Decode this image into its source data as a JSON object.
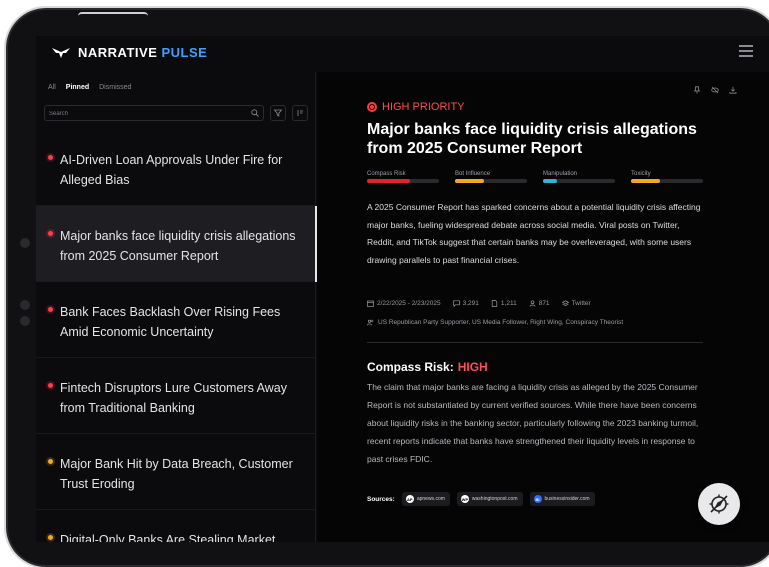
{
  "app": {
    "brand_main": "NARRATIVE",
    "brand_accent": "PULSE",
    "accent_color": "#3ea0ff"
  },
  "filters": {
    "all": "All",
    "pinned": "Pinned",
    "dismissed": "Dismissed",
    "active": "Pinned"
  },
  "search": {
    "placeholder": "Search",
    "value": ""
  },
  "list": [
    {
      "title": "AI-Driven Loan Approvals Under Fire for Alleged Bias",
      "priority_color": "#ff3b4e",
      "selected": false
    },
    {
      "title": "Major banks face liquidity crisis allegations from 2025 Consumer Report",
      "priority_color": "#ff3b4e",
      "selected": true
    },
    {
      "title": "Bank Faces Backlash Over Rising Fees Amid Economic Uncertainty",
      "priority_color": "#ff3b4e",
      "selected": false
    },
    {
      "title": "Fintech Disruptors Lure Customers Away from Traditional Banking",
      "priority_color": "#ff3b4e",
      "selected": false
    },
    {
      "title": "Major Bank Hit by Data Breach, Customer Trust Eroding",
      "priority_color": "#f5a623",
      "selected": false
    },
    {
      "title": "Digital-Only Banks Are Stealing Market",
      "priority_color": "#f5a623",
      "selected": false
    }
  ],
  "detail": {
    "priority": "HIGH PRIORITY",
    "title": "Major banks face liquidity crisis allegations from 2025 Consumer Report",
    "meters": [
      {
        "label": "Compass Risk",
        "value": 0.6,
        "color": "#e8202a"
      },
      {
        "label": "Bot Influence",
        "value": 0.4,
        "color": "#f5a623"
      },
      {
        "label": "Manipulation",
        "value": 0.2,
        "color": "#29b6d8"
      },
      {
        "label": "Toxicity",
        "value": 0.4,
        "color": "#f5a623"
      }
    ],
    "summary": "A 2025 Consumer Report has sparked concerns about a potential liquidity crisis affecting major banks, fueling widespread debate across social media. Viral posts on Twitter, Reddit, and TikTok suggest that certain banks may be overleveraged, with some users drawing parallels to past financial crises.",
    "date_range": "2/22/2025 - 2/23/2025",
    "comments": "3,291",
    "posts": "1,211",
    "users": "871",
    "platform": "Twitter",
    "audiences": "US Republican Party Supporter, US Media Follower, Right Wing, Conspiracy Theorist",
    "risk_label": "Compass Risk:",
    "risk_level": "HIGH",
    "risk_body": "The claim that major banks are facing a liquidity crisis as alleged by the 2025 Consumer Report is not substantiated by current verified sources. While there have been concerns about liquidity risks in the banking sector, particularly following the 2023 banking turmoil, recent reports indicate that banks have strengthened their liquidity levels in response to past crises FDIC.",
    "sources_label": "Sources:",
    "sources": [
      {
        "name": "apnews.com",
        "badge": "AP",
        "color": "#ffffff"
      },
      {
        "name": "washingtonpost.com",
        "badge": "WP",
        "color": "#ffffff"
      },
      {
        "name": "businessinsider.com",
        "badge": "BI",
        "color": "#2f6bff"
      }
    ]
  }
}
